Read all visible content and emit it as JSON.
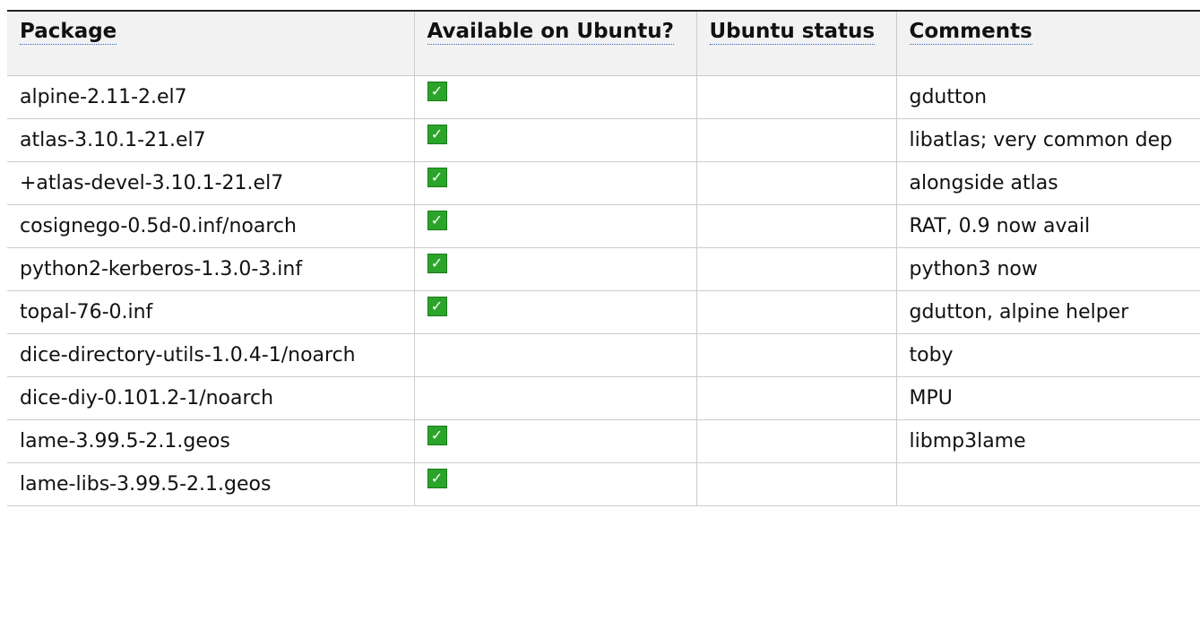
{
  "headers": [
    "Package",
    "Available on Ubuntu?",
    "Ubuntu status",
    "Comments"
  ],
  "check_glyph": "✓",
  "check_color": "#2aa52a",
  "rows": [
    {
      "package": "alpine-2.11-2.el7",
      "available": true,
      "status": "",
      "comments": "gdutton"
    },
    {
      "package": "atlas-3.10.1-21.el7",
      "available": true,
      "status": "",
      "comments": "libatlas; very common dep"
    },
    {
      "package": "+atlas-devel-3.10.1-21.el7",
      "available": true,
      "status": "",
      "comments": "alongside atlas"
    },
    {
      "package": "cosignego-0.5d-0.inf/noarch",
      "available": true,
      "status": "",
      "comments": "RAT, 0.9 now avail"
    },
    {
      "package": "python2-kerberos-1.3.0-3.inf",
      "available": true,
      "status": "",
      "comments": "python3 now"
    },
    {
      "package": "topal-76-0.inf",
      "available": true,
      "status": "",
      "comments": "gdutton, alpine helper"
    },
    {
      "package": "dice-directory-utils-1.0.4-1/noarch",
      "available": false,
      "status": "",
      "comments": "toby"
    },
    {
      "package": "dice-diy-0.101.2-1/noarch",
      "available": false,
      "status": "",
      "comments": "MPU"
    },
    {
      "package": "lame-3.99.5-2.1.geos",
      "available": true,
      "status": "",
      "comments": "libmp3lame"
    },
    {
      "package": "lame-libs-3.99.5-2.1.geos",
      "available": true,
      "status": "",
      "comments": ""
    }
  ]
}
